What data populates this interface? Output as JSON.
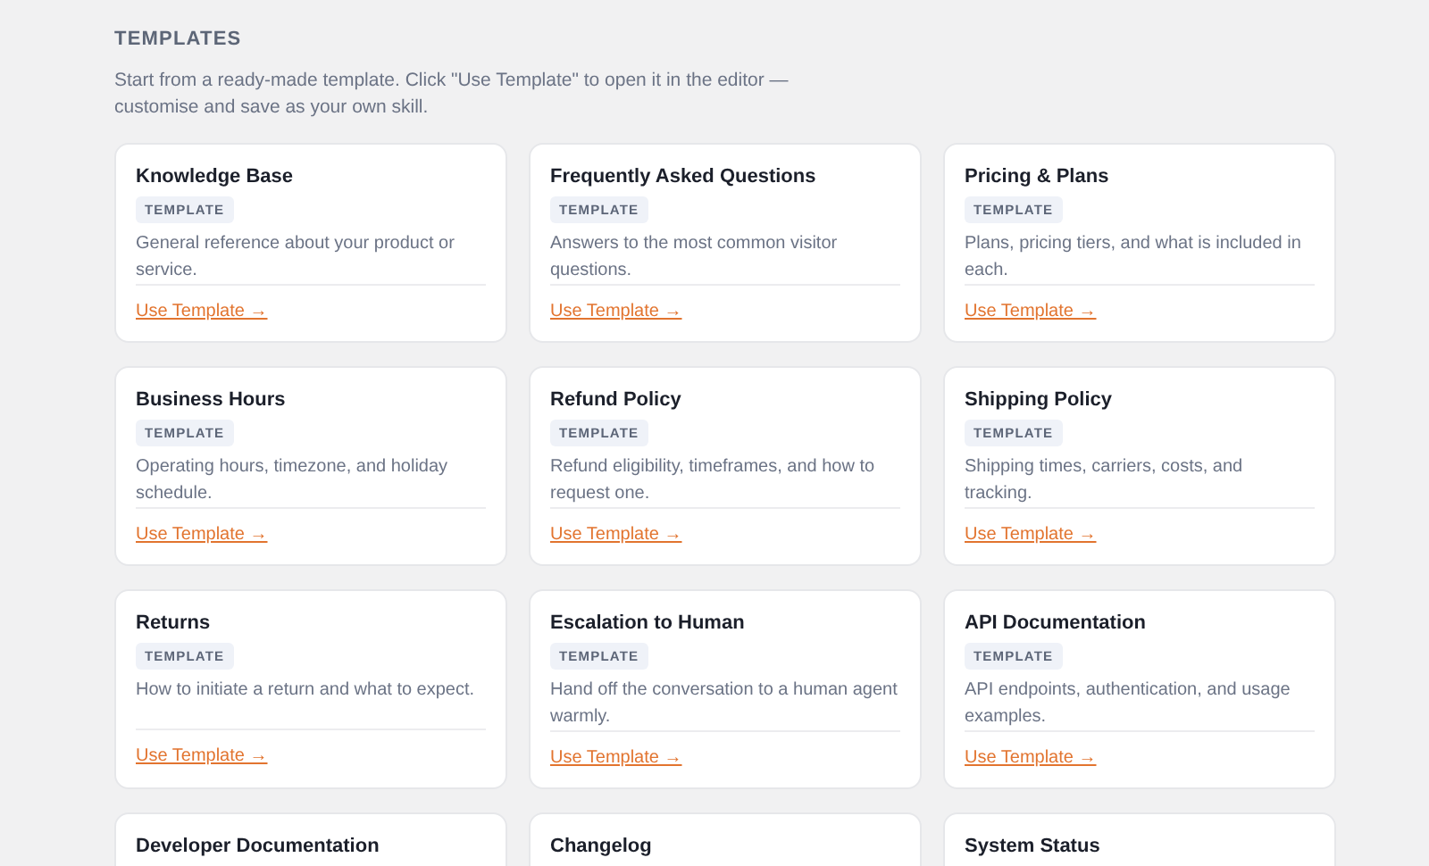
{
  "section": {
    "title": "TEMPLATES",
    "description": "Start from a ready-made template. Click \"Use Template\" to open it in the editor — customise and save as your own skill."
  },
  "templates": [
    {
      "title": "Knowledge Base",
      "badge": "TEMPLATE",
      "description": "General reference about your product or service.",
      "link": "Use Template →"
    },
    {
      "title": "Frequently Asked Questions",
      "badge": "TEMPLATE",
      "description": "Answers to the most common visitor questions.",
      "link": "Use Template →"
    },
    {
      "title": "Pricing & Plans",
      "badge": "TEMPLATE",
      "description": "Plans, pricing tiers, and what is included in each.",
      "link": "Use Template →"
    },
    {
      "title": "Business Hours",
      "badge": "TEMPLATE",
      "description": "Operating hours, timezone, and holiday schedule.",
      "link": "Use Template →"
    },
    {
      "title": "Refund Policy",
      "badge": "TEMPLATE",
      "description": "Refund eligibility, timeframes, and how to request one.",
      "link": "Use Template →"
    },
    {
      "title": "Shipping Policy",
      "badge": "TEMPLATE",
      "description": "Shipping times, carriers, costs, and tracking.",
      "link": "Use Template →"
    },
    {
      "title": "Returns",
      "badge": "TEMPLATE",
      "description": "How to initiate a return and what to expect.",
      "link": "Use Template →"
    },
    {
      "title": "Escalation to Human",
      "badge": "TEMPLATE",
      "description": "Hand off the conversation to a human agent warmly.",
      "link": "Use Template →"
    },
    {
      "title": "API Documentation",
      "badge": "TEMPLATE",
      "description": "API endpoints, authentication, and usage examples.",
      "link": "Use Template →"
    },
    {
      "title": "Developer Documentation"
    },
    {
      "title": "Changelog"
    },
    {
      "title": "System Status"
    }
  ]
}
